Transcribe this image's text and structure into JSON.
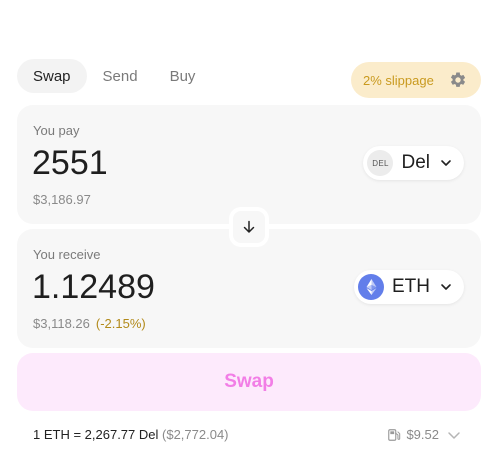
{
  "tabs": [
    {
      "label": "Swap",
      "active": true
    },
    {
      "label": "Send",
      "active": false
    },
    {
      "label": "Buy",
      "active": false
    }
  ],
  "slippage": {
    "label": "2% slippage",
    "icon": "gear-icon"
  },
  "pay": {
    "label": "You pay",
    "amount": "2551",
    "fiat": "$3,186.97",
    "token": {
      "symbol": "Del",
      "icon_text": "DEL"
    }
  },
  "receive": {
    "label": "You receive",
    "amount": "1.12489",
    "fiat": "$3,118.26",
    "delta": "(-2.15%)",
    "token": {
      "symbol": "ETH",
      "icon": "ethereum-icon"
    }
  },
  "swap_button": {
    "label": "Swap"
  },
  "rate": {
    "text": "1 ETH = 2,267.77 Del",
    "usd": "($2,772.04)"
  },
  "gas": {
    "value": "$9.52",
    "icon": "gas-pump-icon"
  },
  "colors": {
    "accent_pink": "#f27ee6",
    "swap_bg": "#fdeafc",
    "slippage_bg": "#fbeccb",
    "slippage_text": "#c99a1f",
    "delta_text": "#b28a1a",
    "eth_blue": "#627eea"
  }
}
